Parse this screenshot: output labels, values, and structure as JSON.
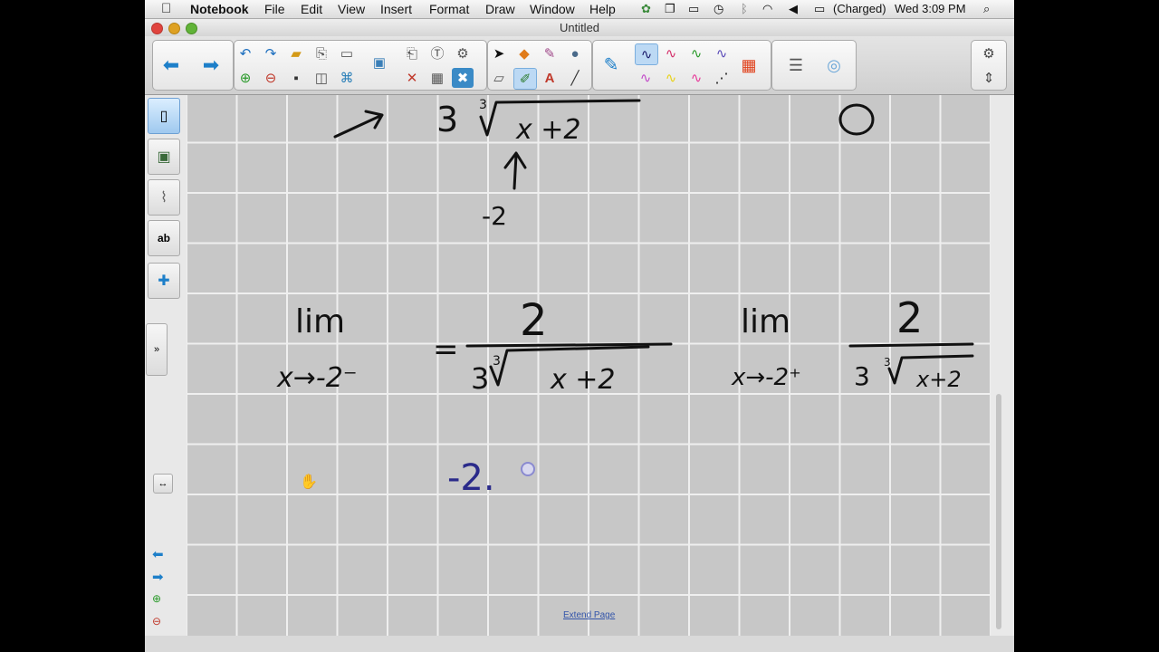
{
  "menubar": {
    "app": "Notebook",
    "items": [
      "File",
      "Edit",
      "View",
      "Insert",
      "Format",
      "Draw",
      "Window",
      "Help"
    ],
    "battery": "(Charged)",
    "clock": "Wed 3:09 PM"
  },
  "window": {
    "title": "Untitled"
  },
  "canvas": {
    "extend_link": "Extend Page",
    "handwriting": {
      "top_left": "↗",
      "top_expr": "3∛(x+2)",
      "top_arrow": "↑",
      "top_value": "-2",
      "top_right": "0",
      "left_lim": "lim",
      "left_sub": "x→-2⁻",
      "equals": "=",
      "left_num": "2",
      "left_den": "3∛(x+2)",
      "right_lim": "lim",
      "right_sub": "x→-2⁺",
      "right_num": "2",
      "right_den": "3∛(x+2)",
      "blue_value": "-2."
    }
  },
  "colors": {
    "ink": "#111111",
    "blue_ink": "#2a2a8a",
    "accent": "#1d7fc9"
  }
}
